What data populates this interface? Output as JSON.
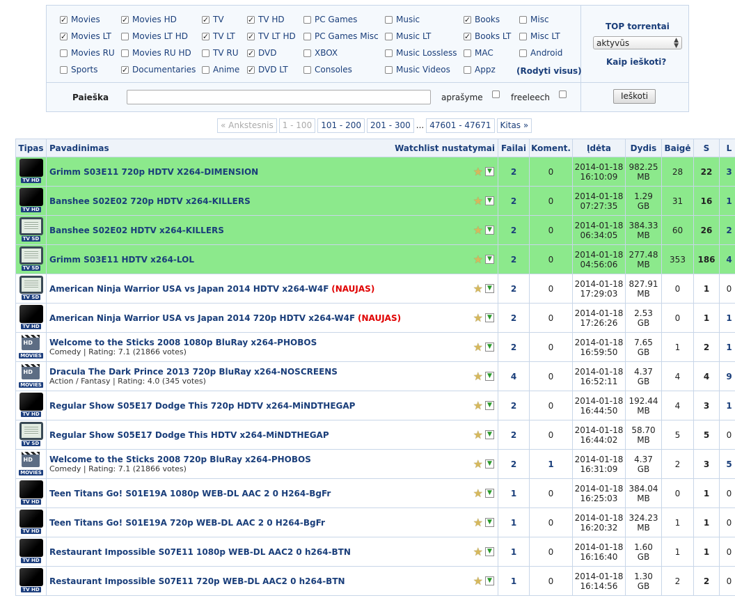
{
  "categories": [
    {
      "label": "Movies",
      "checked": true
    },
    {
      "label": "Movies LT",
      "checked": true
    },
    {
      "label": "Movies RU",
      "checked": false
    },
    {
      "label": "Sports",
      "checked": false
    },
    {
      "label": "Movies HD",
      "checked": true
    },
    {
      "label": "Movies LT HD",
      "checked": false
    },
    {
      "label": "Movies RU HD",
      "checked": false
    },
    {
      "label": "Documentaries",
      "checked": true
    },
    {
      "label": "TV",
      "checked": true
    },
    {
      "label": "TV LT",
      "checked": true
    },
    {
      "label": "TV RU",
      "checked": false
    },
    {
      "label": "Anime",
      "checked": false
    },
    {
      "label": "TV HD",
      "checked": true
    },
    {
      "label": "TV LT HD",
      "checked": true
    },
    {
      "label": "DVD",
      "checked": true
    },
    {
      "label": "DVD LT",
      "checked": true
    },
    {
      "label": "PC Games",
      "checked": false
    },
    {
      "label": "PC Games Misc",
      "checked": false
    },
    {
      "label": "XBOX",
      "checked": false
    },
    {
      "label": "Consoles",
      "checked": false
    },
    {
      "label": "Music",
      "checked": false
    },
    {
      "label": "Music LT",
      "checked": false
    },
    {
      "label": "Music Lossless",
      "checked": false
    },
    {
      "label": "Music Videos",
      "checked": false
    },
    {
      "label": "Books",
      "checked": true
    },
    {
      "label": "Books LT",
      "checked": true
    },
    {
      "label": "MAC",
      "checked": false
    },
    {
      "label": "Appz",
      "checked": false
    },
    {
      "label": "Misc",
      "checked": false
    },
    {
      "label": "Misc LT",
      "checked": false
    },
    {
      "label": "Android",
      "checked": false
    }
  ],
  "show_all": "(Rodyti visus)",
  "top_torrents": {
    "label": "TOP torrentai",
    "selected": "aktyvūs"
  },
  "how_to_search": "Kaip ieškoti?",
  "search": {
    "label": "Paieška",
    "value": "",
    "in_description": "aprašyme",
    "freeleech": "freeleech",
    "button": "Ieškoti"
  },
  "pager": {
    "prev": "« Ankstesnis",
    "current": "1 - 100",
    "pages": [
      "101 - 200",
      "201 - 300"
    ],
    "dots": "...",
    "last": "47601 - 47671",
    "next": "Kitas »"
  },
  "columns": {
    "type": "Tipas",
    "name": "Pavadinimas",
    "watchlist": "Watchlist nustatymai",
    "files": "Failai",
    "comments": "Koment.",
    "added": "Įdėta",
    "size": "Dydis",
    "completed": "Baigė",
    "seeders": "S",
    "leechers": "L"
  },
  "rows": [
    {
      "icon": "tv-hd",
      "icon_label": "TV HD",
      "name": "Grimm S03E11 720p HDTV X264-DIMENSION",
      "new": "",
      "sub": "",
      "files": "2",
      "comments": "0",
      "date": "2014-01-18",
      "time": "16:10:09",
      "size": "982.25",
      "unit": "MB",
      "completed": "28",
      "seeders": "22",
      "leechers": "3",
      "highlight": true
    },
    {
      "icon": "tv-hd",
      "icon_label": "TV HD",
      "name": "Banshee S02E02 720p HDTV x264-KILLERS",
      "new": "",
      "sub": "",
      "files": "2",
      "comments": "0",
      "date": "2014-01-18",
      "time": "07:27:35",
      "size": "1.29",
      "unit": "GB",
      "completed": "31",
      "seeders": "16",
      "leechers": "1",
      "highlight": true
    },
    {
      "icon": "tv-sd",
      "icon_label": "TV SD",
      "name": "Banshee S02E02 HDTV x264-KILLERS",
      "new": "",
      "sub": "",
      "files": "2",
      "comments": "0",
      "date": "2014-01-18",
      "time": "06:34:05",
      "size": "384.33",
      "unit": "MB",
      "completed": "60",
      "seeders": "26",
      "leechers": "2",
      "highlight": true
    },
    {
      "icon": "tv-sd",
      "icon_label": "TV SD",
      "name": "Grimm S03E11 HDTV x264-LOL",
      "new": "",
      "sub": "",
      "files": "2",
      "comments": "0",
      "date": "2014-01-18",
      "time": "04:56:06",
      "size": "277.48",
      "unit": "MB",
      "completed": "353",
      "seeders": "186",
      "leechers": "4",
      "highlight": true
    },
    {
      "icon": "tv-sd",
      "icon_label": "TV SD",
      "name": "American Ninja Warrior USA vs Japan 2014 HDTV x264-W4F",
      "new": "NAUJAS",
      "sub": "",
      "files": "2",
      "comments": "0",
      "date": "2014-01-18",
      "time": "17:29:03",
      "size": "827.91",
      "unit": "MB",
      "completed": "0",
      "seeders": "1",
      "leechers": "0",
      "highlight": false
    },
    {
      "icon": "tv-hd",
      "icon_label": "TV HD",
      "name": "American Ninja Warrior USA vs Japan 2014 720p HDTV x264-W4F",
      "new": "NAUJAS",
      "sub": "",
      "files": "2",
      "comments": "0",
      "date": "2014-01-18",
      "time": "17:26:26",
      "size": "2.53",
      "unit": "GB",
      "completed": "0",
      "seeders": "1",
      "leechers": "1",
      "highlight": false
    },
    {
      "icon": "movies-hd",
      "icon_label": "MOVIES",
      "name": "Welcome to the Sticks 2008 1080p BluRay x264-PHOBOS",
      "new": "",
      "sub": "Comedy | Rating: 7.1 (21866 votes)",
      "files": "2",
      "comments": "0",
      "date": "2014-01-18",
      "time": "16:59:50",
      "size": "7.65",
      "unit": "GB",
      "completed": "1",
      "seeders": "2",
      "leechers": "1",
      "highlight": false
    },
    {
      "icon": "movies-hd",
      "icon_label": "MOVIES",
      "name": "Dracula The Dark Prince 2013 720p BluRay x264-NOSCREENS",
      "new": "",
      "sub": "Action / Fantasy | Rating: 4.0 (345 votes)",
      "files": "4",
      "comments": "0",
      "date": "2014-01-18",
      "time": "16:52:11",
      "size": "4.37",
      "unit": "GB",
      "completed": "4",
      "seeders": "4",
      "leechers": "9",
      "highlight": false
    },
    {
      "icon": "tv-hd",
      "icon_label": "TV HD",
      "name": "Regular Show S05E17 Dodge This 720p HDTV x264-MiNDTHEGAP",
      "new": "",
      "sub": "",
      "files": "2",
      "comments": "0",
      "date": "2014-01-18",
      "time": "16:44:50",
      "size": "192.44",
      "unit": "MB",
      "completed": "4",
      "seeders": "3",
      "leechers": "1",
      "highlight": false
    },
    {
      "icon": "tv-sd",
      "icon_label": "TV SD",
      "name": "Regular Show S05E17 Dodge This HDTV x264-MiNDTHEGAP",
      "new": "",
      "sub": "",
      "files": "2",
      "comments": "0",
      "date": "2014-01-18",
      "time": "16:44:02",
      "size": "58.70",
      "unit": "MB",
      "completed": "5",
      "seeders": "5",
      "leechers": "0",
      "highlight": false
    },
    {
      "icon": "movies-hd",
      "icon_label": "MOVIES",
      "name": "Welcome to the Sticks 2008 720p BluRay x264-PHOBOS",
      "new": "",
      "sub": "Comedy | Rating: 7.1 (21866 votes)",
      "files": "2",
      "comments": "1",
      "date": "2014-01-18",
      "time": "16:31:09",
      "size": "4.37",
      "unit": "GB",
      "completed": "2",
      "seeders": "3",
      "leechers": "5",
      "highlight": false
    },
    {
      "icon": "tv-hd",
      "icon_label": "TV HD",
      "name": "Teen Titans Go! S01E19A 1080p WEB-DL AAC 2 0 H264-BgFr",
      "new": "",
      "sub": "",
      "files": "1",
      "comments": "0",
      "date": "2014-01-18",
      "time": "16:25:03",
      "size": "384.04",
      "unit": "MB",
      "completed": "0",
      "seeders": "1",
      "leechers": "0",
      "highlight": false
    },
    {
      "icon": "tv-hd",
      "icon_label": "TV HD",
      "name": "Teen Titans Go! S01E19A 720p WEB-DL AAC 2 0 H264-BgFr",
      "new": "",
      "sub": "",
      "files": "1",
      "comments": "0",
      "date": "2014-01-18",
      "time": "16:20:32",
      "size": "324.23",
      "unit": "MB",
      "completed": "1",
      "seeders": "1",
      "leechers": "0",
      "highlight": false
    },
    {
      "icon": "tv-hd",
      "icon_label": "TV HD",
      "name": "Restaurant Impossible S07E11 1080p WEB-DL AAC2 0 h264-BTN",
      "new": "",
      "sub": "",
      "files": "1",
      "comments": "0",
      "date": "2014-01-18",
      "time": "16:16:40",
      "size": "1.60",
      "unit": "GB",
      "completed": "1",
      "seeders": "1",
      "leechers": "0",
      "highlight": false
    },
    {
      "icon": "tv-hd",
      "icon_label": "TV HD",
      "name": "Restaurant Impossible S07E11 720p WEB-DL AAC2 0 h264-BTN",
      "new": "",
      "sub": "",
      "files": "1",
      "comments": "0",
      "date": "2014-01-18",
      "time": "16:14:56",
      "size": "1.30",
      "unit": "GB",
      "completed": "2",
      "seeders": "2",
      "leechers": "0",
      "highlight": false
    }
  ]
}
